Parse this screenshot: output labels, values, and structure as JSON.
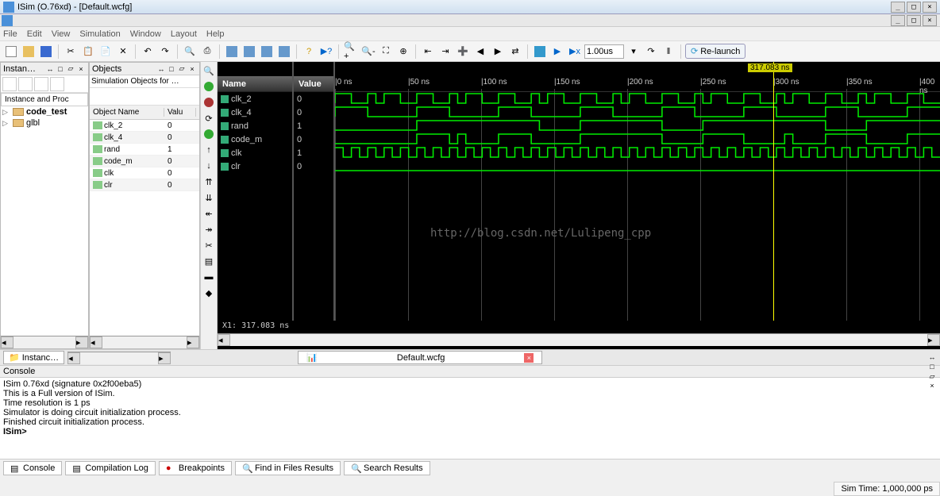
{
  "window": {
    "title": "ISim (O.76xd) - [Default.wcfg]"
  },
  "menu": [
    "File",
    "Edit",
    "View",
    "Simulation",
    "Window",
    "Layout",
    "Help"
  ],
  "toolbar": {
    "time_input": "1.00us",
    "relaunch": "Re-launch"
  },
  "instances": {
    "panel_title": "Instan…",
    "tab": "Instance and Proc",
    "tree": [
      {
        "name": "code_test",
        "kind": "module"
      },
      {
        "name": "glbl",
        "kind": "module"
      }
    ],
    "bottom_tab": "Instanc…"
  },
  "objects": {
    "panel_title": "Objects",
    "subtitle": "Simulation Objects for …",
    "columns": {
      "name": "Object Name",
      "value": "Valu"
    },
    "rows": [
      {
        "name": "clk_2",
        "value": "0"
      },
      {
        "name": "clk_4",
        "value": "0"
      },
      {
        "name": "rand",
        "value": "1"
      },
      {
        "name": "code_m",
        "value": "0"
      },
      {
        "name": "clk",
        "value": "0"
      },
      {
        "name": "clr",
        "value": "0"
      }
    ]
  },
  "wave": {
    "name_header": "Name",
    "value_header": "Value",
    "cursor_label": "317.083 ns",
    "cursor_status": "X1: 317.083 ns",
    "ticks": [
      "0 ns",
      "50 ns",
      "100 ns",
      "150 ns",
      "200 ns",
      "250 ns",
      "300 ns",
      "350 ns",
      "400 ns"
    ],
    "signals": [
      {
        "name": "clk_2",
        "value": "0"
      },
      {
        "name": "clk_4",
        "value": "0"
      },
      {
        "name": "rand",
        "value": "1"
      },
      {
        "name": "code_m",
        "value": "0"
      },
      {
        "name": "clk",
        "value": "1"
      },
      {
        "name": "clr",
        "value": "0"
      }
    ],
    "watermark": "http://blog.csdn.net/Lulipeng_cpp",
    "doc_tab": "Default.wcfg"
  },
  "console": {
    "title": "Console",
    "lines": [
      "ISim 0.76xd (signature 0x2f00eba5)",
      "This is a Full version of ISim.",
      "Time resolution is 1 ps",
      "Simulator is doing circuit initialization process.",
      "Finished circuit initialization process."
    ],
    "prompt": "ISim>"
  },
  "bottom_tabs": [
    "Console",
    "Compilation Log",
    "Breakpoints",
    "Find in Files Results",
    "Search Results"
  ],
  "status": {
    "sim_time": "Sim Time: 1,000,000 ps"
  }
}
